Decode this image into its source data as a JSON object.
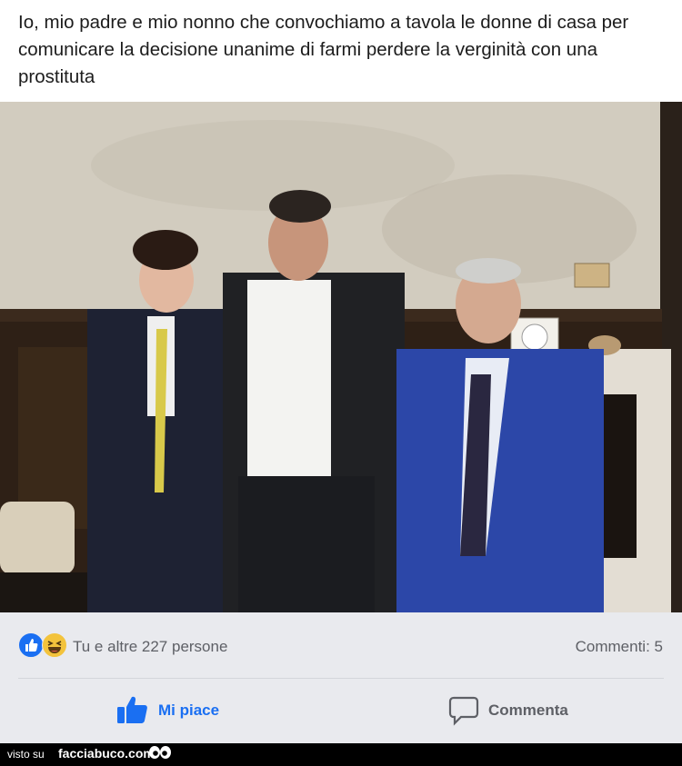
{
  "caption": {
    "text": "Io, mio padre e mio nonno che convochiamo a tavola le donne di casa per comunicare la decisione unanime di farmi perdere la verginità con una prostituta"
  },
  "photo": {
    "alt": ""
  },
  "reactions": {
    "icons": [
      "like-icon",
      "haha-icon"
    ],
    "text": "Tu e altre 227 persone",
    "comments": "Commenti: 5"
  },
  "actions": {
    "like_label": "Mi piace",
    "comment_label": "Commenta"
  },
  "footer": {
    "visto": "visto su",
    "site": "facciabuco.com"
  },
  "colors": {
    "accent": "#1a6ff2",
    "bar": "#e9eaee",
    "muted": "#5e6066"
  }
}
